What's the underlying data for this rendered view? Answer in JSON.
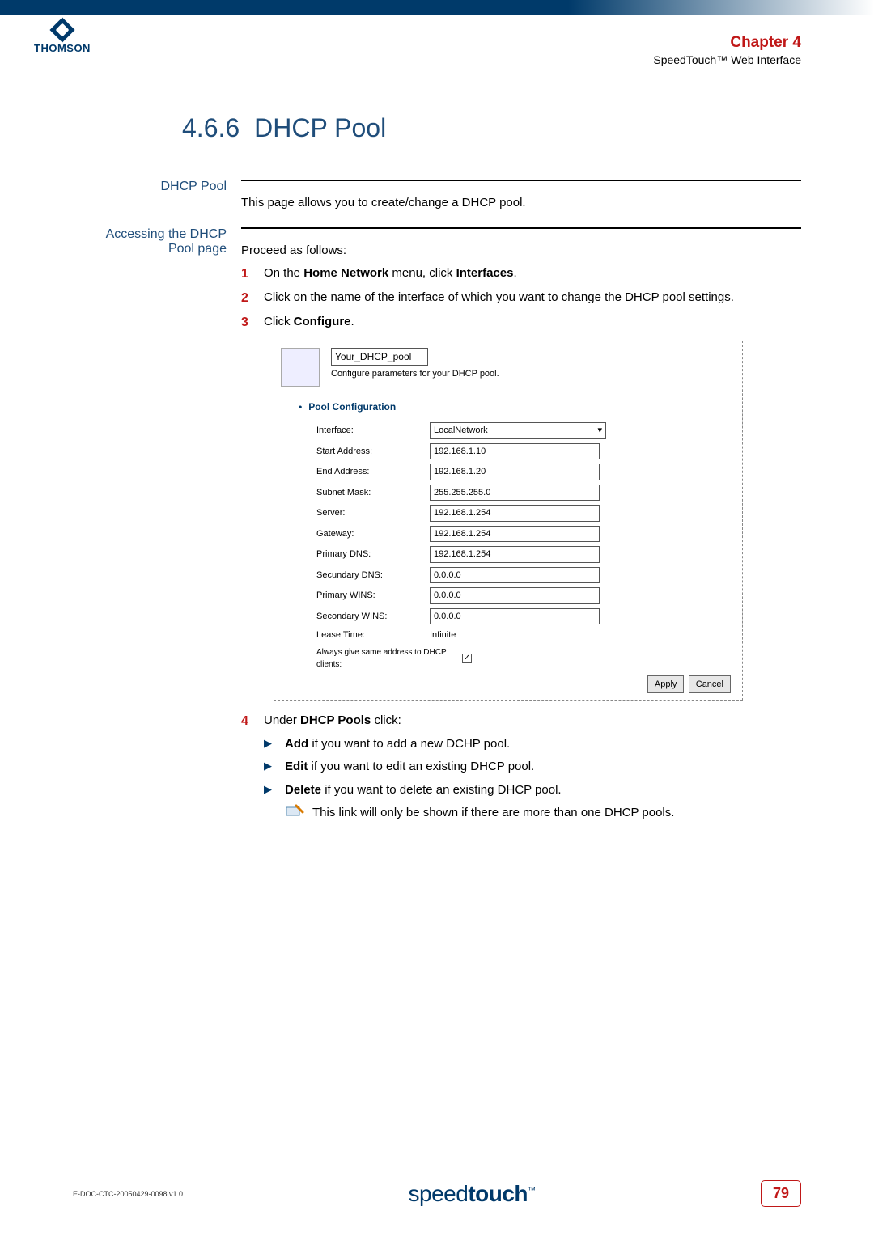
{
  "logo_text": "THOMSON",
  "chapter": {
    "title": "Chapter 4",
    "subtitle": "SpeedTouch™ Web Interface"
  },
  "heading": {
    "number": "4.6.6",
    "title": "DHCP Pool"
  },
  "dhcp_pool_block": {
    "runin": "DHCP Pool",
    "text": "This page allows you to create/change a DHCP pool."
  },
  "access_block": {
    "runin": "Accessing the DHCP Pool page",
    "intro": "Proceed as follows:",
    "steps": {
      "s1": {
        "num": "1",
        "text_pre": "On the ",
        "menu": "Home Network",
        "text_mid": " menu, click ",
        "item": "Interfaces",
        "text_post": "."
      },
      "s2": {
        "num": "2",
        "text": "Click on the name of the interface of which you want to change the DHCP pool settings."
      },
      "s3": {
        "num": "3",
        "text_pre": "Click ",
        "item": "Configure",
        "text_post": "."
      },
      "s4": {
        "num": "4",
        "text_pre": "Under ",
        "item": "DHCP Pools",
        "text_post": " click:"
      }
    }
  },
  "screenshot": {
    "pool_name": "Your_DHCP_pool",
    "subtitle": "Configure parameters for your DHCP pool.",
    "section_head": "Pool Configuration",
    "fields": {
      "interface": {
        "label": "Interface:",
        "value": "LocalNetwork",
        "type": "select"
      },
      "start": {
        "label": "Start Address:",
        "value": "192.168.1.10"
      },
      "end": {
        "label": "End Address:",
        "value": "192.168.1.20"
      },
      "subnet": {
        "label": "Subnet Mask:",
        "value": "255.255.255.0"
      },
      "server": {
        "label": "Server:",
        "value": "192.168.1.254"
      },
      "gateway": {
        "label": "Gateway:",
        "value": "192.168.1.254"
      },
      "pdns": {
        "label": "Primary DNS:",
        "value": "192.168.1.254"
      },
      "sdns": {
        "label": "Secundary DNS:",
        "value": "0.0.0.0"
      },
      "pwins": {
        "label": "Primary WINS:",
        "value": "0.0.0.0"
      },
      "swins": {
        "label": "Secondary WINS:",
        "value": "0.0.0.0"
      },
      "lease": {
        "label": "Lease Time:",
        "value": "Infinite"
      },
      "same": {
        "label": "Always give same address to DHCP clients:",
        "checked": "✓"
      }
    },
    "buttons": {
      "apply": "Apply",
      "cancel": "Cancel"
    }
  },
  "bullets": {
    "add": {
      "bold": "Add",
      "rest": " if you want to add a new DCHP pool."
    },
    "edit": {
      "bold": "Edit",
      "rest": " if you want to edit an existing DHCP pool."
    },
    "delete": {
      "bold": "Delete",
      "rest": " if you want to delete an existing DHCP pool."
    },
    "note": "This link will only be shown if there are more than one DHCP pools."
  },
  "footer": {
    "doc_id": "E-DOC-CTC-20050429-0098 v1.0",
    "brand_light": "speed",
    "brand_bold": "touch",
    "tm": "™",
    "page": "79"
  }
}
